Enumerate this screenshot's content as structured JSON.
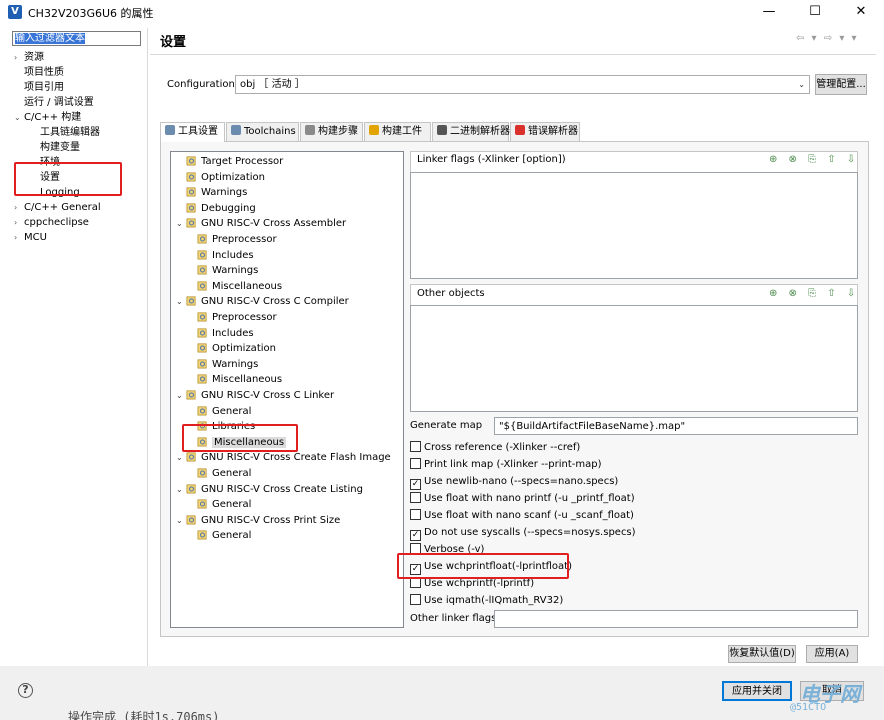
{
  "window": {
    "title": "CH32V203G6U6 的属性",
    "app_icon": "V",
    "minimize": "—",
    "maximize": "☐",
    "close": "✕"
  },
  "left": {
    "filter_placeholder": "输入过滤器文本",
    "items": [
      {
        "label": "资源",
        "expander": "›"
      },
      {
        "label": "项目性质",
        "expander": ""
      },
      {
        "label": "项目引用",
        "expander": ""
      },
      {
        "label": "运行 / 调试设置",
        "expander": ""
      },
      {
        "label": "C/C++ 构建",
        "expander": "⌄"
      },
      {
        "label": "工具链编辑器",
        "expander": ""
      },
      {
        "label": "构建变量",
        "expander": ""
      },
      {
        "label": "环境",
        "expander": ""
      },
      {
        "label": "设置",
        "expander": ""
      },
      {
        "label": "Logging",
        "expander": ""
      },
      {
        "label": "C/C++ General",
        "expander": "›"
      },
      {
        "label": "cppcheclipse",
        "expander": "›"
      },
      {
        "label": "MCU",
        "expander": "›"
      }
    ]
  },
  "header": {
    "title": "设置",
    "nav": "⇦ ▾ ⇨ ▾ ▾"
  },
  "config": {
    "label": "Configuration:",
    "value": "obj ［ 活动 ］",
    "manage_button": "管理配置..."
  },
  "tabs": [
    {
      "label": "工具设置",
      "icon": "gear-icon",
      "color": "#6b8cae"
    },
    {
      "label": "Toolchains",
      "icon": "toolchain-icon",
      "color": "#6b8cae"
    },
    {
      "label": "构建步骤",
      "icon": "steps-icon",
      "color": "#8a8a8a"
    },
    {
      "label": "构建工件",
      "icon": "artifact-icon",
      "color": "#e2a400"
    },
    {
      "label": "二进制解析器",
      "icon": "binary-icon",
      "color": "#555555"
    },
    {
      "label": "错误解析器",
      "icon": "error-icon",
      "color": "#d9302c"
    }
  ],
  "settings_tree": [
    {
      "label": "Target Processor",
      "indent": 0,
      "arrow": ""
    },
    {
      "label": "Optimization",
      "indent": 0,
      "arrow": ""
    },
    {
      "label": "Warnings",
      "indent": 0,
      "arrow": ""
    },
    {
      "label": "Debugging",
      "indent": 0,
      "arrow": ""
    },
    {
      "label": "GNU RISC-V Cross Assembler",
      "indent": 0,
      "arrow": "⌄"
    },
    {
      "label": "Preprocessor",
      "indent": 1,
      "arrow": ""
    },
    {
      "label": "Includes",
      "indent": 1,
      "arrow": ""
    },
    {
      "label": "Warnings",
      "indent": 1,
      "arrow": ""
    },
    {
      "label": "Miscellaneous",
      "indent": 1,
      "arrow": ""
    },
    {
      "label": "GNU RISC-V Cross C Compiler",
      "indent": 0,
      "arrow": "⌄"
    },
    {
      "label": "Preprocessor",
      "indent": 1,
      "arrow": ""
    },
    {
      "label": "Includes",
      "indent": 1,
      "arrow": ""
    },
    {
      "label": "Optimization",
      "indent": 1,
      "arrow": ""
    },
    {
      "label": "Warnings",
      "indent": 1,
      "arrow": ""
    },
    {
      "label": "Miscellaneous",
      "indent": 1,
      "arrow": ""
    },
    {
      "label": "GNU RISC-V Cross C Linker",
      "indent": 0,
      "arrow": "⌄"
    },
    {
      "label": "General",
      "indent": 1,
      "arrow": ""
    },
    {
      "label": "Libraries",
      "indent": 1,
      "arrow": ""
    },
    {
      "label": "Miscellaneous",
      "indent": 1,
      "arrow": ""
    },
    {
      "label": "GNU RISC-V Cross Create Flash Image",
      "indent": 0,
      "arrow": "⌄"
    },
    {
      "label": "General",
      "indent": 1,
      "arrow": ""
    },
    {
      "label": "GNU RISC-V Cross Create Listing",
      "indent": 0,
      "arrow": "⌄"
    },
    {
      "label": "General",
      "indent": 1,
      "arrow": ""
    },
    {
      "label": "GNU RISC-V Cross Print Size",
      "indent": 0,
      "arrow": "⌄"
    },
    {
      "label": "General",
      "indent": 1,
      "arrow": ""
    }
  ],
  "linker_flags": {
    "label": "Linker flags (-Xlinker [option])",
    "tools": "⊕ ⊗ ⎘ ⇧ ⇩"
  },
  "other_objects": {
    "label": "Other objects",
    "tools": "⊕ ⊗ ⎘ ⇧ ⇩"
  },
  "generate_map": {
    "label": "Generate map",
    "value": "\"${BuildArtifactFileBaseName}.map\""
  },
  "options": [
    {
      "label": "Cross reference (-Xlinker --cref)",
      "checked": ""
    },
    {
      "label": "Print link map (-Xlinker --print-map)",
      "checked": ""
    },
    {
      "label": "Use newlib-nano (--specs=nano.specs)",
      "checked": "✓"
    },
    {
      "label": "Use float with nano printf (-u _printf_float)",
      "checked": ""
    },
    {
      "label": "Use float with nano scanf (-u _scanf_float)",
      "checked": ""
    },
    {
      "label": "Do not use syscalls (--specs=nosys.specs)",
      "checked": "✓"
    },
    {
      "label": "Verbose (-v)",
      "checked": ""
    },
    {
      "label": "Use wchprintfloat(-lprintfloat)",
      "checked": "✓"
    },
    {
      "label": "Use wchprintf(-lprintf)",
      "checked": ""
    },
    {
      "label": "Use iqmath(-lIQmath_RV32)",
      "checked": ""
    }
  ],
  "other_linker_flags": {
    "label": "Other linker flags",
    "value": ""
  },
  "buttons": {
    "restore_defaults": "恢复默认值(D)",
    "apply": "应用(A)",
    "apply_close": "应用并关闭",
    "cancel": "取消"
  },
  "footer": {
    "help": "?",
    "console": "操作完成 (耗时1s.706ms)",
    "watermark": "电子网",
    "watermark_sub": "@51CTO"
  }
}
